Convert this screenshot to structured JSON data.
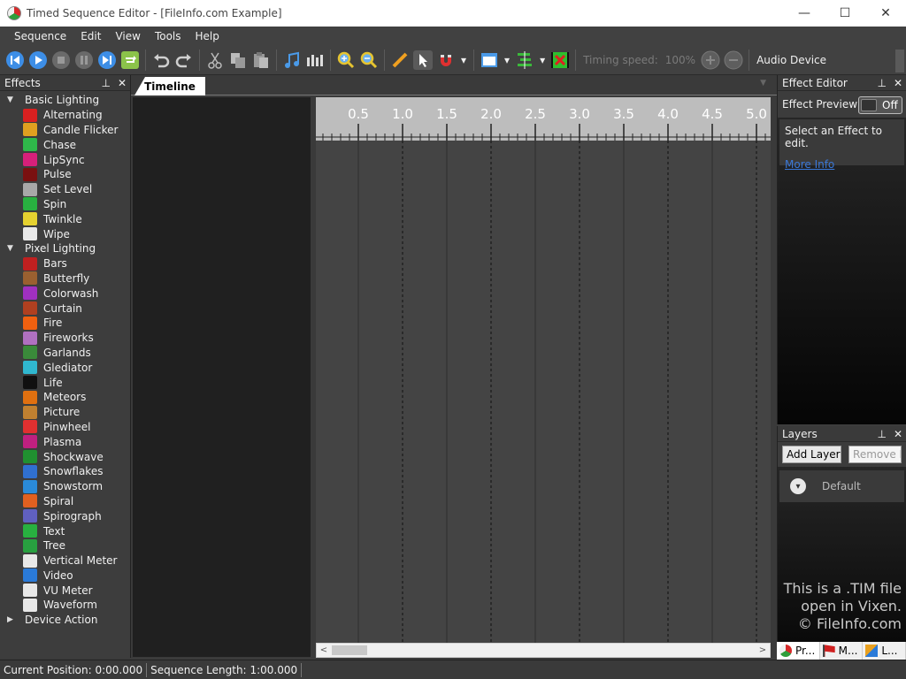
{
  "window": {
    "title": "Timed Sequence Editor - [FileInfo.com Example]",
    "minimize_glyph": "—",
    "maximize_glyph": "☐",
    "close_glyph": "✕"
  },
  "menu": [
    "Sequence",
    "Edit",
    "View",
    "Tools",
    "Help"
  ],
  "toolbar": {
    "timing_speed_label": "Timing speed:",
    "timing_speed_value": "100%",
    "audio_device_label": "Audio Device"
  },
  "effects_panel": {
    "title": "Effects",
    "pin_glyph": "📌",
    "close_glyph": "✕",
    "categories": [
      {
        "name": "Basic Lighting",
        "expanded": true,
        "items": [
          {
            "label": "Alternating",
            "icon": "alternating-icon",
            "color": "#d92020"
          },
          {
            "label": "Candle Flicker",
            "icon": "candle-icon",
            "color": "#e0a020"
          },
          {
            "label": "Chase",
            "icon": "chase-icon",
            "color": "#2fb84a"
          },
          {
            "label": "LipSync",
            "icon": "lips-icon",
            "color": "#d6207a"
          },
          {
            "label": "Pulse",
            "icon": "pulse-icon",
            "color": "#7a1010"
          },
          {
            "label": "Set Level",
            "icon": "set-level-icon",
            "color": "#a8a8a8"
          },
          {
            "label": "Spin",
            "icon": "spin-icon",
            "color": "#28b040"
          },
          {
            "label": "Twinkle",
            "icon": "star-icon",
            "color": "#e6d230"
          },
          {
            "label": "Wipe",
            "icon": "wipe-icon",
            "color": "#e8e8e8"
          }
        ]
      },
      {
        "name": "Pixel Lighting",
        "expanded": true,
        "items": [
          {
            "label": "Bars",
            "icon": "bars-icon",
            "color": "#c02020"
          },
          {
            "label": "Butterfly",
            "icon": "butterfly-icon",
            "color": "#9a6030"
          },
          {
            "label": "Colorwash",
            "icon": "colorwash-icon",
            "color": "#a030c0"
          },
          {
            "label": "Curtain",
            "icon": "curtain-icon",
            "color": "#b04020"
          },
          {
            "label": "Fire",
            "icon": "fire-icon",
            "color": "#f06010"
          },
          {
            "label": "Fireworks",
            "icon": "fireworks-icon",
            "color": "#b070c0"
          },
          {
            "label": "Garlands",
            "icon": "garlands-icon",
            "color": "#3a8a3a"
          },
          {
            "label": "Glediator",
            "icon": "glediator-icon",
            "color": "#30b8d0"
          },
          {
            "label": "Life",
            "icon": "life-icon",
            "color": "#101010"
          },
          {
            "label": "Meteors",
            "icon": "meteor-icon",
            "color": "#e07010"
          },
          {
            "label": "Picture",
            "icon": "picture-icon",
            "color": "#c08030"
          },
          {
            "label": "Pinwheel",
            "icon": "pinwheel-icon",
            "color": "#e03030"
          },
          {
            "label": "Plasma",
            "icon": "plasma-icon",
            "color": "#c02080"
          },
          {
            "label": "Shockwave",
            "icon": "shockwave-icon",
            "color": "#209030"
          },
          {
            "label": "Snowflakes",
            "icon": "snowflake-icon",
            "color": "#3070d0"
          },
          {
            "label": "Snowstorm",
            "icon": "snowstorm-icon",
            "color": "#2a8ad8"
          },
          {
            "label": "Spiral",
            "icon": "spiral-icon",
            "color": "#e06020"
          },
          {
            "label": "Spirograph",
            "icon": "spirograph-icon",
            "color": "#6060c0"
          },
          {
            "label": "Text",
            "icon": "text-icon",
            "color": "#28b040"
          },
          {
            "label": "Tree",
            "icon": "tree-icon",
            "color": "#28a040"
          },
          {
            "label": "Vertical Meter",
            "icon": "music-note-icon",
            "color": "#e8e8e8"
          },
          {
            "label": "Video",
            "icon": "video-camera-icon",
            "color": "#2a7ad8"
          },
          {
            "label": "VU Meter",
            "icon": "music-note-icon",
            "color": "#e8e8e8"
          },
          {
            "label": "Waveform",
            "icon": "music-note-icon",
            "color": "#e8e8e8"
          }
        ]
      },
      {
        "name": "Device Action",
        "expanded": false,
        "items": []
      }
    ]
  },
  "timeline": {
    "tab_label": "Timeline",
    "ruler_ticks": [
      "0.5",
      "1.0",
      "1.5",
      "2.0",
      "2.5",
      "3.0",
      "3.5",
      "4.0",
      "4.5",
      "5.0"
    ],
    "scroll_left": "<",
    "scroll_right": ">"
  },
  "effect_editor": {
    "title": "Effect Editor",
    "preview_label": "Effect Preview",
    "toggle_label": "Off",
    "info_text": "Select an Effect to edit.",
    "more_info": "More Info"
  },
  "layers": {
    "title": "Layers",
    "add_button": "Add Layer",
    "remove_button": "Remove Layer",
    "default_layer": "Default"
  },
  "watermark": {
    "line1": "This is a .TIM file",
    "line2": "open in Vixen.",
    "line3": "© FileInfo.com"
  },
  "bottom_tabs": [
    "Pr...",
    "M...",
    "L..."
  ],
  "status": {
    "current_position_label": "Current Position:",
    "current_position_value": "0:00.000",
    "sequence_length_label": "Sequence Length:",
    "sequence_length_value": "1:00.000"
  }
}
